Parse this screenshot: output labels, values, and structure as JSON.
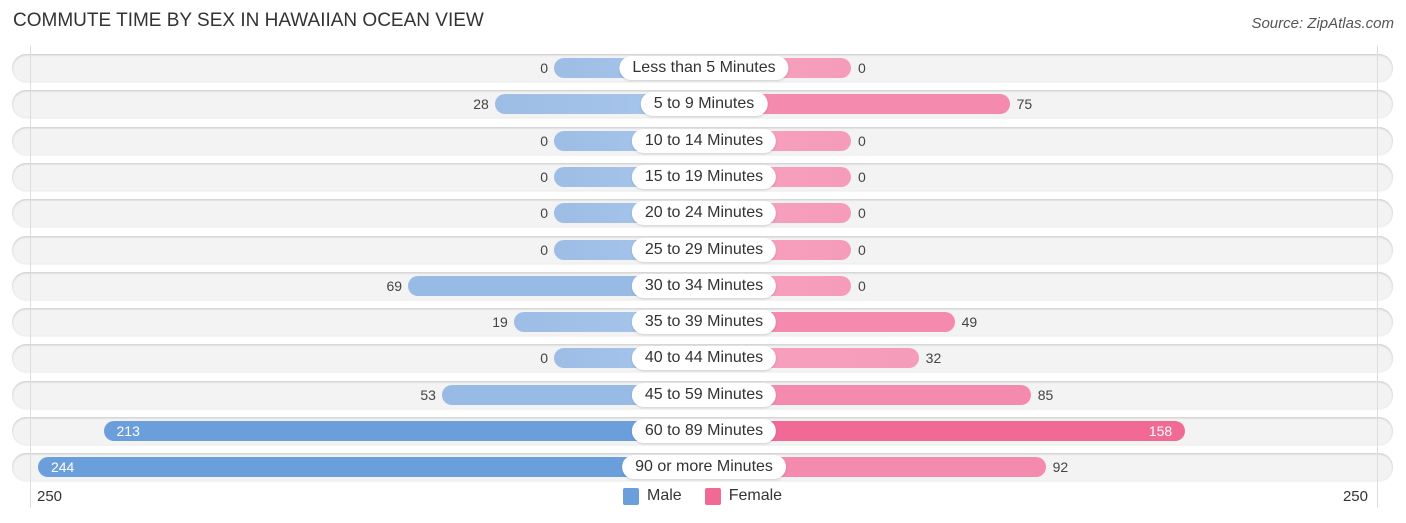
{
  "title": "COMMUTE TIME BY SEX IN HAWAIIAN OCEAN VIEW",
  "source": "Source: ZipAtlas.com",
  "colors": {
    "male": "#6a9fdb",
    "female": "#f06a95"
  },
  "legend": [
    {
      "label": "Male",
      "color": "#6a9fdb"
    },
    {
      "label": "Female",
      "color": "#f06a95"
    }
  ],
  "axis": {
    "left_label": "250",
    "right_label": "250"
  },
  "chart_data": {
    "type": "bar",
    "orientation": "horizontal-diverging",
    "title": "COMMUTE TIME BY SEX IN HAWAIIAN OCEAN VIEW",
    "categories": [
      "Less than 5 Minutes",
      "5 to 9 Minutes",
      "10 to 14 Minutes",
      "15 to 19 Minutes",
      "20 to 24 Minutes",
      "25 to 29 Minutes",
      "30 to 34 Minutes",
      "35 to 39 Minutes",
      "40 to 44 Minutes",
      "45 to 59 Minutes",
      "60 to 89 Minutes",
      "90 or more Minutes"
    ],
    "series": [
      {
        "name": "Male",
        "values": [
          0,
          28,
          0,
          0,
          0,
          0,
          69,
          19,
          0,
          53,
          213,
          244
        ]
      },
      {
        "name": "Female",
        "values": [
          0,
          75,
          0,
          0,
          0,
          0,
          0,
          49,
          32,
          85,
          158,
          92
        ]
      }
    ],
    "xlim": [
      -250,
      250
    ],
    "xlabel": "",
    "ylabel": "",
    "legend_position": "bottom-center",
    "grid": false
  }
}
